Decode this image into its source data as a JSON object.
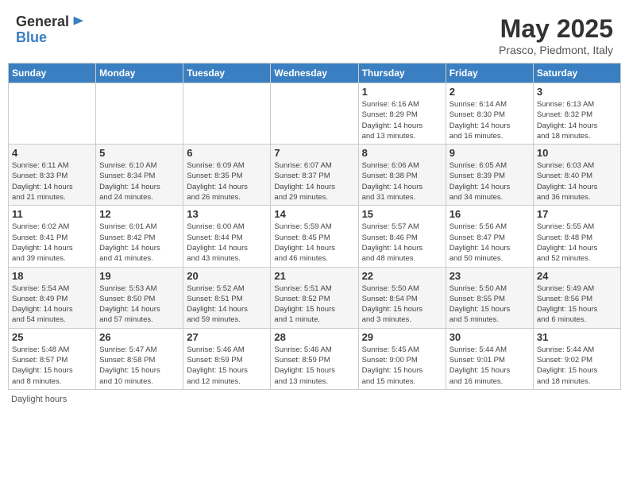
{
  "header": {
    "logo_line1": "General",
    "logo_line2": "Blue",
    "month_title": "May 2025",
    "subtitle": "Prasco, Piedmont, Italy"
  },
  "days_of_week": [
    "Sunday",
    "Monday",
    "Tuesday",
    "Wednesday",
    "Thursday",
    "Friday",
    "Saturday"
  ],
  "weeks": [
    [
      {
        "day": "",
        "info": ""
      },
      {
        "day": "",
        "info": ""
      },
      {
        "day": "",
        "info": ""
      },
      {
        "day": "",
        "info": ""
      },
      {
        "day": "1",
        "info": "Sunrise: 6:16 AM\nSunset: 8:29 PM\nDaylight: 14 hours\nand 13 minutes."
      },
      {
        "day": "2",
        "info": "Sunrise: 6:14 AM\nSunset: 8:30 PM\nDaylight: 14 hours\nand 16 minutes."
      },
      {
        "day": "3",
        "info": "Sunrise: 6:13 AM\nSunset: 8:32 PM\nDaylight: 14 hours\nand 18 minutes."
      }
    ],
    [
      {
        "day": "4",
        "info": "Sunrise: 6:11 AM\nSunset: 8:33 PM\nDaylight: 14 hours\nand 21 minutes."
      },
      {
        "day": "5",
        "info": "Sunrise: 6:10 AM\nSunset: 8:34 PM\nDaylight: 14 hours\nand 24 minutes."
      },
      {
        "day": "6",
        "info": "Sunrise: 6:09 AM\nSunset: 8:35 PM\nDaylight: 14 hours\nand 26 minutes."
      },
      {
        "day": "7",
        "info": "Sunrise: 6:07 AM\nSunset: 8:37 PM\nDaylight: 14 hours\nand 29 minutes."
      },
      {
        "day": "8",
        "info": "Sunrise: 6:06 AM\nSunset: 8:38 PM\nDaylight: 14 hours\nand 31 minutes."
      },
      {
        "day": "9",
        "info": "Sunrise: 6:05 AM\nSunset: 8:39 PM\nDaylight: 14 hours\nand 34 minutes."
      },
      {
        "day": "10",
        "info": "Sunrise: 6:03 AM\nSunset: 8:40 PM\nDaylight: 14 hours\nand 36 minutes."
      }
    ],
    [
      {
        "day": "11",
        "info": "Sunrise: 6:02 AM\nSunset: 8:41 PM\nDaylight: 14 hours\nand 39 minutes."
      },
      {
        "day": "12",
        "info": "Sunrise: 6:01 AM\nSunset: 8:42 PM\nDaylight: 14 hours\nand 41 minutes."
      },
      {
        "day": "13",
        "info": "Sunrise: 6:00 AM\nSunset: 8:44 PM\nDaylight: 14 hours\nand 43 minutes."
      },
      {
        "day": "14",
        "info": "Sunrise: 5:59 AM\nSunset: 8:45 PM\nDaylight: 14 hours\nand 46 minutes."
      },
      {
        "day": "15",
        "info": "Sunrise: 5:57 AM\nSunset: 8:46 PM\nDaylight: 14 hours\nand 48 minutes."
      },
      {
        "day": "16",
        "info": "Sunrise: 5:56 AM\nSunset: 8:47 PM\nDaylight: 14 hours\nand 50 minutes."
      },
      {
        "day": "17",
        "info": "Sunrise: 5:55 AM\nSunset: 8:48 PM\nDaylight: 14 hours\nand 52 minutes."
      }
    ],
    [
      {
        "day": "18",
        "info": "Sunrise: 5:54 AM\nSunset: 8:49 PM\nDaylight: 14 hours\nand 54 minutes."
      },
      {
        "day": "19",
        "info": "Sunrise: 5:53 AM\nSunset: 8:50 PM\nDaylight: 14 hours\nand 57 minutes."
      },
      {
        "day": "20",
        "info": "Sunrise: 5:52 AM\nSunset: 8:51 PM\nDaylight: 14 hours\nand 59 minutes."
      },
      {
        "day": "21",
        "info": "Sunrise: 5:51 AM\nSunset: 8:52 PM\nDaylight: 15 hours\nand 1 minute."
      },
      {
        "day": "22",
        "info": "Sunrise: 5:50 AM\nSunset: 8:54 PM\nDaylight: 15 hours\nand 3 minutes."
      },
      {
        "day": "23",
        "info": "Sunrise: 5:50 AM\nSunset: 8:55 PM\nDaylight: 15 hours\nand 5 minutes."
      },
      {
        "day": "24",
        "info": "Sunrise: 5:49 AM\nSunset: 8:56 PM\nDaylight: 15 hours\nand 6 minutes."
      }
    ],
    [
      {
        "day": "25",
        "info": "Sunrise: 5:48 AM\nSunset: 8:57 PM\nDaylight: 15 hours\nand 8 minutes."
      },
      {
        "day": "26",
        "info": "Sunrise: 5:47 AM\nSunset: 8:58 PM\nDaylight: 15 hours\nand 10 minutes."
      },
      {
        "day": "27",
        "info": "Sunrise: 5:46 AM\nSunset: 8:59 PM\nDaylight: 15 hours\nand 12 minutes."
      },
      {
        "day": "28",
        "info": "Sunrise: 5:46 AM\nSunset: 8:59 PM\nDaylight: 15 hours\nand 13 minutes."
      },
      {
        "day": "29",
        "info": "Sunrise: 5:45 AM\nSunset: 9:00 PM\nDaylight: 15 hours\nand 15 minutes."
      },
      {
        "day": "30",
        "info": "Sunrise: 5:44 AM\nSunset: 9:01 PM\nDaylight: 15 hours\nand 16 minutes."
      },
      {
        "day": "31",
        "info": "Sunrise: 5:44 AM\nSunset: 9:02 PM\nDaylight: 15 hours\nand 18 minutes."
      }
    ]
  ],
  "footer": {
    "daylight_label": "Daylight hours"
  },
  "colors": {
    "header_bg": "#3a7fc1",
    "odd_row_bg": "#ffffff",
    "even_row_bg": "#f5f5f5"
  }
}
